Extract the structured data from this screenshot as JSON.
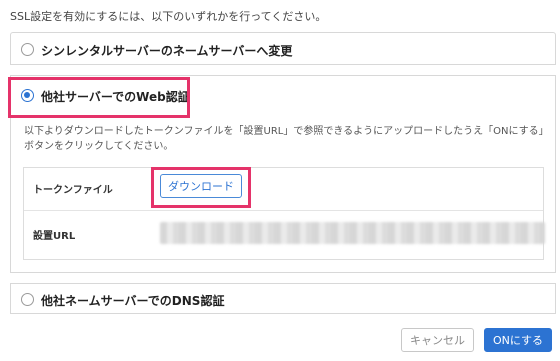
{
  "intro_text": "SSL設定を有効にするには、以下のいずれかを行ってください。",
  "options": [
    {
      "label": "シンレンタルサーバーのネームサーバーへ変更",
      "selected": false
    },
    {
      "label": "他社サーバーでのWeb認証",
      "selected": true
    },
    {
      "label": "他社ネームサーバーでのDNS認証",
      "selected": false
    }
  ],
  "web_auth": {
    "description": "以下よりダウンロードしたトークンファイルを「設置URL」で参照できるようにアップロードしたうえ「ONにする」ボタンをクリックしてください。",
    "token_file_label": "トークンファイル",
    "download_button": "ダウンロード",
    "install_url_label": "設置URL"
  },
  "footer": {
    "cancel_button": "キャンセル",
    "on_button": "ONにする"
  },
  "colors": {
    "accent": "#2c73d2",
    "highlight": "#e5336a"
  }
}
